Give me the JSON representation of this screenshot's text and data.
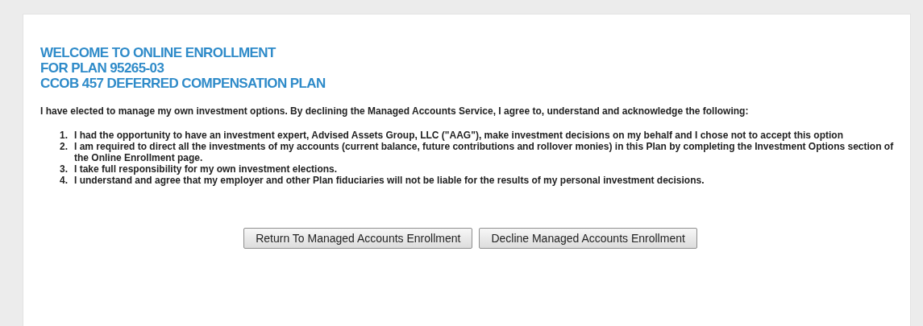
{
  "heading": [
    "WELCOME TO ONLINE ENROLLMENT",
    "FOR PLAN 95265-03",
    "CCOB 457 DEFERRED COMPENSATION PLAN"
  ],
  "intro": "I have elected to manage my own investment options. By declining the Managed Accounts Service, I agree to, understand and acknowledge the following:",
  "items": [
    {
      "number": "1.",
      "text": "I had the opportunity to have an investment expert, Advised Assets Group, LLC (\"AAG\"), make investment decisions on my behalf and I chose not to accept this option"
    },
    {
      "number": "2.",
      "text": "I am required to direct all the investments of my accounts (current balance, future contributions and rollover monies) in this Plan by completing the Investment Options section of the Online Enrollment page."
    },
    {
      "number": "3.",
      "text": "I take full responsibility for my own investment elections."
    },
    {
      "number": "4.",
      "text": "I understand and agree that my employer and other Plan fiduciaries will not be liable for the results of my personal investment decisions."
    }
  ],
  "buttons": [
    "Return To Managed Accounts Enrollment",
    "Decline Managed Accounts Enrollment"
  ]
}
